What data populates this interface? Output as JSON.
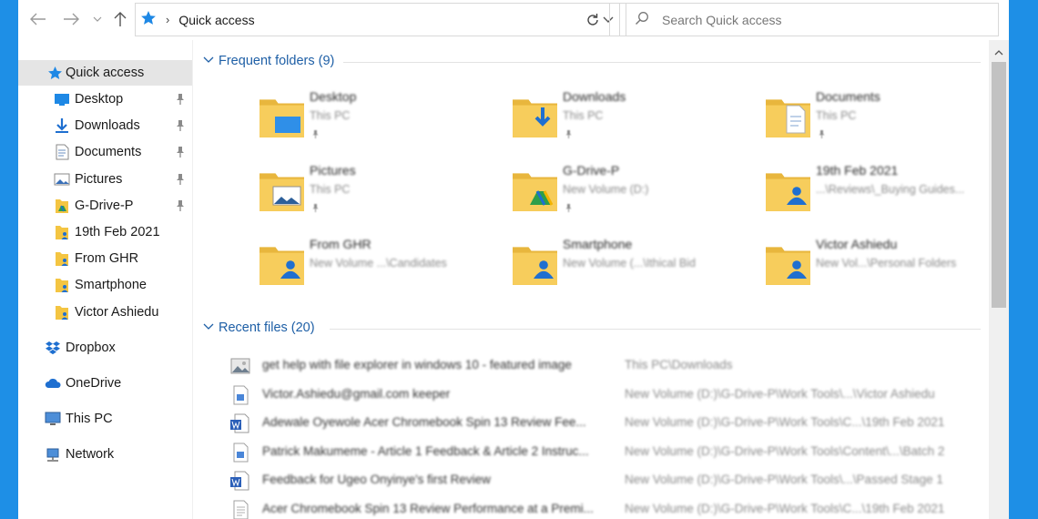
{
  "address": {
    "crumb": "Quick access"
  },
  "search": {
    "placeholder": "Search Quick access"
  },
  "nav": {
    "quick_access": "Quick access",
    "items": [
      {
        "label": "Desktop",
        "icon": "desktop-icon",
        "pinned": true
      },
      {
        "label": "Downloads",
        "icon": "downloads-icon",
        "pinned": true
      },
      {
        "label": "Documents",
        "icon": "documents-icon",
        "pinned": true
      },
      {
        "label": "Pictures",
        "icon": "pictures-icon",
        "pinned": true
      },
      {
        "label": "G-Drive-P",
        "icon": "gdrive-folder-icon",
        "pinned": true
      },
      {
        "label": "19th Feb 2021",
        "icon": "user-folder-icon",
        "pinned": false
      },
      {
        "label": "From GHR",
        "icon": "user-folder-icon",
        "pinned": false
      },
      {
        "label": "Smartphone",
        "icon": "user-folder-icon",
        "pinned": false
      },
      {
        "label": "Victor Ashiedu",
        "icon": "user-folder-icon",
        "pinned": false
      }
    ],
    "roots": [
      {
        "label": "Dropbox",
        "icon": "dropbox-icon"
      },
      {
        "label": "OneDrive",
        "icon": "onedrive-icon"
      },
      {
        "label": "This PC",
        "icon": "this-pc-icon"
      },
      {
        "label": "Network",
        "icon": "network-icon"
      }
    ]
  },
  "frequent": {
    "title": "Frequent folders (9)",
    "folders": [
      {
        "name": "Desktop",
        "location": "This PC",
        "pinned": true,
        "overlay": "desktop"
      },
      {
        "name": "Downloads",
        "location": "This PC",
        "pinned": true,
        "overlay": "download"
      },
      {
        "name": "Documents",
        "location": "This PC",
        "pinned": true,
        "overlay": "document"
      },
      {
        "name": "Pictures",
        "location": "This PC",
        "pinned": true,
        "overlay": "picture"
      },
      {
        "name": "G-Drive-P",
        "location": "New Volume (D:)",
        "pinned": true,
        "overlay": "gdrive"
      },
      {
        "name": "19th Feb 2021",
        "location": "...\\Reviews\\_Buying Guides...",
        "pinned": false,
        "overlay": "user"
      },
      {
        "name": "From GHR",
        "location": "New Volume ...\\Candidates",
        "pinned": false,
        "overlay": "user"
      },
      {
        "name": "Smartphone",
        "location": "New Volume (...\\Ithical Bid",
        "pinned": false,
        "overlay": "user"
      },
      {
        "name": "Victor Ashiedu",
        "location": "New Vol...\\Personal Folders",
        "pinned": false,
        "overlay": "user"
      }
    ]
  },
  "recent": {
    "title": "Recent files (20)",
    "files": [
      {
        "name": "get help with file explorer in windows 10 - featured image",
        "path": "This PC\\Downloads",
        "icon": "image-file-icon"
      },
      {
        "name": "Victor.Ashiedu@gmail.com keeper",
        "path": "New Volume (D:)\\G-Drive-P\\Work Tools\\...\\Victor Ashiedu",
        "icon": "generic-file-icon"
      },
      {
        "name": "Adewale Oyewole Acer Chromebook Spin 13 Review Fee...",
        "path": "New Volume (D:)\\G-Drive-P\\Work Tools\\C...\\19th Feb 2021",
        "icon": "word-file-icon"
      },
      {
        "name": "Patrick Makumeme - Article 1 Feedback & Article 2 Instruc...",
        "path": "New Volume (D:)\\G-Drive-P\\Work Tools\\Content\\...\\Batch 2",
        "icon": "generic-file-icon"
      },
      {
        "name": "Feedback for Ugeo Onyinye's first Review",
        "path": "New Volume (D:)\\G-Drive-P\\Work Tools\\...\\Passed Stage 1",
        "icon": "word-file-icon"
      },
      {
        "name": "Acer Chromebook Spin 13 Review Performance at a Premi...",
        "path": "New Volume (D:)\\G-Drive-P\\Work Tools\\C...\\19th Feb 2021",
        "icon": "text-file-icon"
      }
    ]
  }
}
